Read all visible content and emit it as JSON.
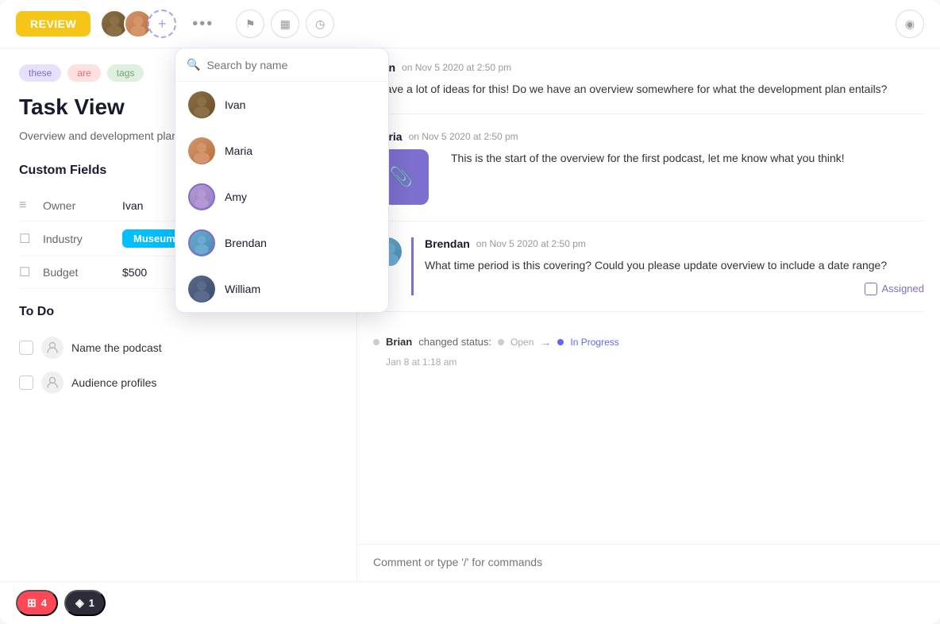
{
  "header": {
    "review_label": "REVIEW",
    "more_icon": "•••",
    "icons": [
      {
        "name": "flag-icon",
        "symbol": "⚑"
      },
      {
        "name": "calendar-icon",
        "symbol": "▦"
      },
      {
        "name": "clock-icon",
        "symbol": "◷"
      },
      {
        "name": "eye-icon",
        "symbol": "◉"
      }
    ]
  },
  "tags": [
    {
      "label": "these",
      "class": "tag-these"
    },
    {
      "label": "are",
      "class": "tag-are"
    },
    {
      "label": "tags",
      "class": "tag-tags"
    }
  ],
  "task": {
    "title": "Task View",
    "description": "Overview and development plan for our original podcast series.",
    "custom_fields_title": "Custom Fields",
    "fields": [
      {
        "icon": "≡",
        "label": "Owner",
        "value": "Ivan"
      },
      {
        "icon": "☐",
        "label": "Industry",
        "value": "Museum"
      },
      {
        "icon": "☐",
        "label": "Budget",
        "value": "$500"
      }
    ],
    "todo_title": "To Do",
    "todos": [
      {
        "label": "Name the podcast"
      },
      {
        "label": "Audience profiles"
      }
    ]
  },
  "dropdown": {
    "placeholder": "Search by name",
    "people": [
      {
        "name": "Ivan",
        "avatar_class": "da-ivan"
      },
      {
        "name": "Maria",
        "avatar_class": "da-maria"
      },
      {
        "name": "Amy",
        "avatar_class": "da-amy"
      },
      {
        "name": "Brendan",
        "avatar_class": "da-brendan"
      },
      {
        "name": "William",
        "avatar_class": "da-william"
      }
    ]
  },
  "comments": [
    {
      "author": "Ivan",
      "time": "on Nov 5 2020 at 2:50 pm",
      "text": "I have a lot of ideas for this! Do we have an overview somewhere for what the development plan entails?"
    },
    {
      "author": "Maria",
      "time": "on Nov 5 2020 at 2:50 pm",
      "text": "This is the start of the overview for the first podcast, let me know what you think!",
      "has_attachment": true,
      "attachment_icon": "📎"
    },
    {
      "author": "Brendan",
      "time": "on Nov 5 2020 at 2:50 pm",
      "text": "What time period is this covering? Could you please update overview to include a date range?",
      "has_assigned": true,
      "assigned_label": "Assigned",
      "has_left_border": true
    }
  ],
  "status_change": {
    "author": "Brian",
    "action": "changed status:",
    "from_status": "Open",
    "to_status": "In Progress",
    "time": "Jan 8 at 1:18 am"
  },
  "comment_input": {
    "placeholder": "Comment or type '/' for commands"
  },
  "bottom_bar": {
    "badge1_icon": "⊞",
    "badge1_count": "4",
    "badge2_icon": "◈",
    "badge2_count": "1"
  }
}
